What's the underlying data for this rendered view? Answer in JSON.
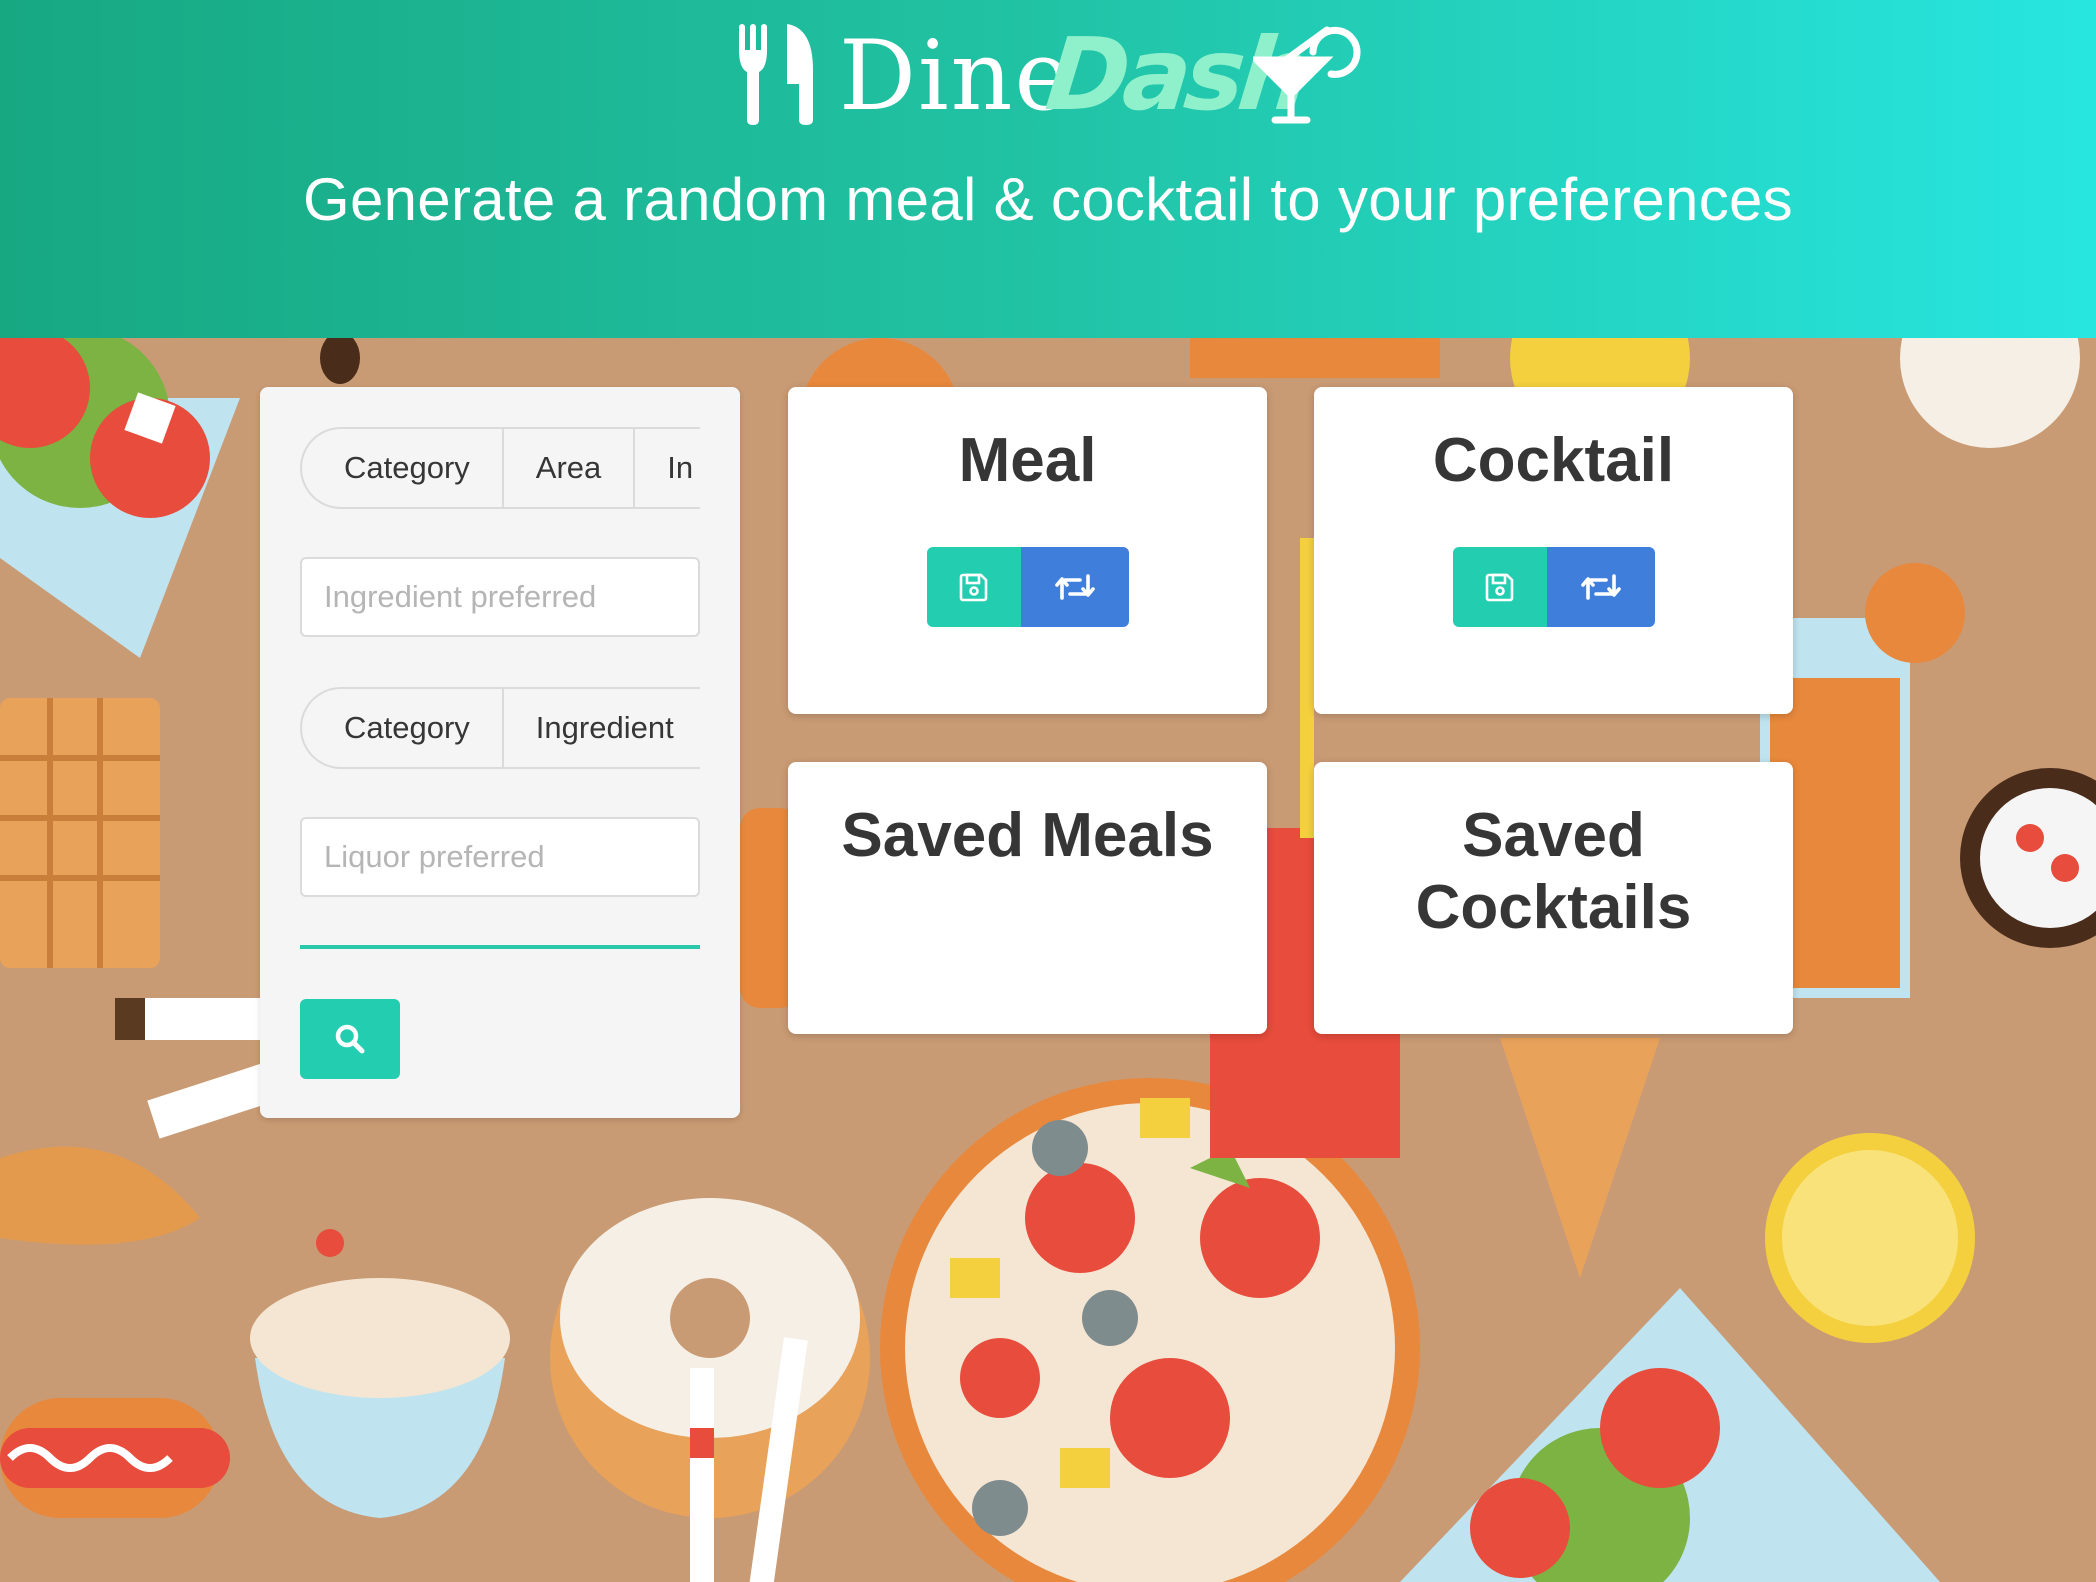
{
  "header": {
    "logo_dine": "Dine",
    "logo_dash": "Dash",
    "tagline": "Generate a random meal & cocktail to your preferences"
  },
  "colors": {
    "header_start": "#17a882",
    "header_end": "#27e6e0",
    "save_button": "#23ceb0",
    "swap_button": "#3f7edb",
    "background": "#c99b74"
  },
  "meal_filters": {
    "tabs": [
      "Category",
      "Area",
      "In"
    ],
    "ingredient_placeholder": "Ingredient preferred"
  },
  "cocktail_filters": {
    "tabs": [
      "Category",
      "Ingredient"
    ],
    "liquor_placeholder": "Liquor preferred"
  },
  "search_button": {
    "icon": "search-icon"
  },
  "cards": {
    "meal": {
      "title": "Meal",
      "save_icon": "save-icon",
      "swap_icon": "retweet-icon"
    },
    "cocktail": {
      "title": "Cocktail",
      "save_icon": "save-icon",
      "swap_icon": "retweet-icon"
    },
    "saved_meals": {
      "title": "Saved Meals"
    },
    "saved_cocktails": {
      "title_line1": "Saved",
      "title_line2": "Cocktails"
    }
  }
}
